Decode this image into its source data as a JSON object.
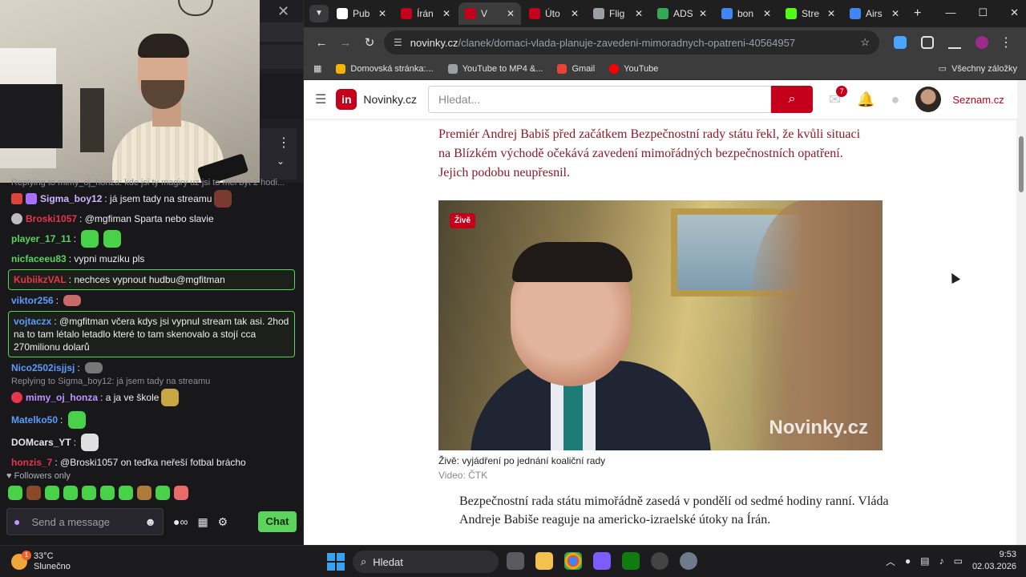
{
  "stream": {
    "close_glyph": "✕",
    "kebab_glyph": "⋮",
    "chevron_glyph": "⌄"
  },
  "chat": {
    "top_reply": "Replying to mimy_oj_honza: kde jsi ty magiry uz jsi to mel byt 2 hodi...",
    "messages": [
      {
        "user": "Sigma_boy12",
        "color": "#c9b8ff",
        "text": "já jsem tady na streamu",
        "highlight": false
      },
      {
        "user": "Broski1057",
        "color": "#e8344d",
        "text": "@mgfiman Sparta nebo slavie",
        "highlight": false
      },
      {
        "user": "player_17_11",
        "color": "#5cd35c",
        "text": "",
        "highlight": false
      },
      {
        "user": "nicfaceeu83",
        "color": "#5cd35c",
        "text": "vypni muziku pls",
        "highlight": false
      },
      {
        "user": "KubiikzVAL",
        "color": "#e8344d",
        "text": "nechces vypnout hudbu@mgfitman",
        "highlight": true
      },
      {
        "user": "viktor256",
        "color": "#5b9cff",
        "text": "",
        "highlight": false
      },
      {
        "user": "vojtaczx",
        "color": "#5b9cff",
        "text": "@mgfitman včera kdys jsi vypnul stream tak asi. 2hod na to tam létalo letadlo které to tam skenovalo a stojí cca 270milionu dolarů",
        "highlight": true
      },
      {
        "user": "Nico2502isjjsj",
        "color": "#5b9cff",
        "text": "",
        "highlight": false
      }
    ],
    "reply2": "Replying to Sigma_boy12: já jsem tady na streamu",
    "messages2": [
      {
        "user": "mimy_oj_honza",
        "color": "#bf94ff",
        "text": "a ja ve škole"
      },
      {
        "user": "Matelko50",
        "color": "#5b9cff",
        "text": ""
      },
      {
        "user": "DOMcars_YT",
        "color": "#e5e5ea",
        "text": ""
      },
      {
        "user": "honzis_7",
        "color": "#e8344d",
        "text": "@Broski1057 on teďka neřeší fotbal brácho"
      }
    ],
    "followers": "Followers only",
    "send_placeholder": "Send a message",
    "chat_button": "Chat"
  },
  "browser": {
    "tabs": [
      {
        "label": "Pub",
        "fav_color": "#ffffff",
        "active": false
      },
      {
        "label": "Írán",
        "fav_color": "#c4001a",
        "active": false
      },
      {
        "label": "V",
        "fav_color": "#c4001a",
        "active": true
      },
      {
        "label": "Úto",
        "fav_color": "#c4001a",
        "active": false
      },
      {
        "label": "Flig",
        "fav_color": "#9aa0a6",
        "active": false
      },
      {
        "label": "ADS",
        "fav_color": "#34a853",
        "active": false
      },
      {
        "label": "bon",
        "fav_color": "#4285f4",
        "active": false
      },
      {
        "label": "Stre",
        "fav_color": "#53fc18",
        "active": false
      },
      {
        "label": "Airs",
        "fav_color": "#4285f4",
        "active": false
      }
    ],
    "url_domain": "novinky.cz",
    "url_path": "/clanek/domaci-vlada-planuje-zavedeni-mimoradnych-opatreni-40564957",
    "bookmarks": [
      {
        "label": "Domovská stránka:...",
        "color": "#f4b400"
      },
      {
        "label": "YouTube to MP4 &...",
        "color": "#9aa0a6"
      },
      {
        "label": "Gmail",
        "color": "#ea4335"
      },
      {
        "label": "YouTube",
        "color": "#ff0000"
      }
    ],
    "all_bookmarks": "Všechny záložky"
  },
  "site": {
    "logo_letter": "in",
    "logo_text": "Novinky.cz",
    "search_placeholder": "Hledat...",
    "notification_count": "7",
    "seznam": "Seznam.cz",
    "lead": "Premiér Andrej Babiš před začátkem Bezpečnostní rady státu řekl, že kvůli situaci na Blízkém východě očekává zavedení mimořádných bezpečnostních opatření. Jejich podobu neupřesnil.",
    "live_badge": "Živě",
    "watermark": "Novinky.cz",
    "caption": "Živě: vyjádření po jednání koaliční rady",
    "credit": "Video: ČTK",
    "body": "Bezpečnostní rada státu mimořádně zasedá v pondělí od sedmé hodiny ranní. Vláda Andreje Babiše reaguje na americko-izraelské útoky na Írán."
  },
  "taskbar": {
    "temp": "33°C",
    "weather": "Slunečno",
    "weather_badge": "1",
    "search": "Hledat",
    "time": "9:53",
    "date": "02.03.2026"
  }
}
